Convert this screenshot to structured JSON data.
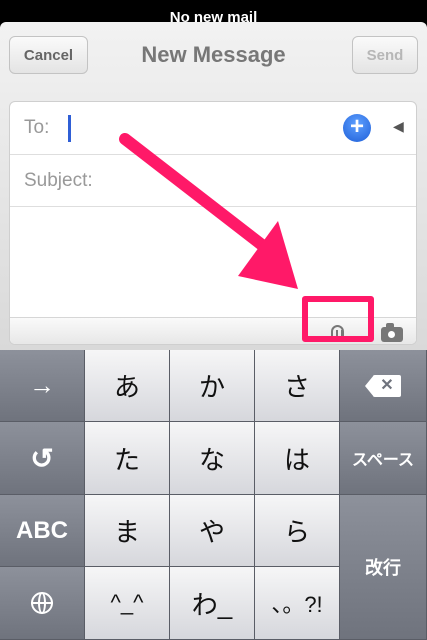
{
  "status_bar": {
    "text": "No new mail"
  },
  "nav": {
    "cancel": "Cancel",
    "title": "New Message",
    "send": "Send"
  },
  "compose": {
    "to_label": "To:",
    "subject_label": "Subject:",
    "add_contact_symbol": "+"
  },
  "keyboard": {
    "rows": [
      {
        "left": "→",
        "keys": [
          "あ",
          "か",
          "さ"
        ],
        "right": "⌫"
      },
      {
        "left": "↺",
        "keys": [
          "た",
          "な",
          "は"
        ],
        "right": "スペース"
      },
      {
        "left": "ABC",
        "keys": [
          "ま",
          "や",
          "ら"
        ],
        "right": "改行"
      },
      {
        "left": "globe",
        "keys": [
          "^_^",
          "わ_",
          "、。?!"
        ]
      }
    ]
  },
  "annotation": {
    "color": "#ff1968"
  }
}
